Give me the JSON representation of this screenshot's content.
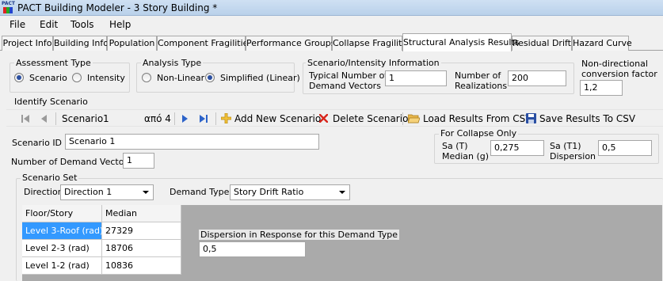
{
  "window": {
    "title": "PACT Building Modeler - 3 Story Building *",
    "logo_text": "PACT"
  },
  "menu": [
    "File",
    "Edit",
    "Tools",
    "Help"
  ],
  "tabs": [
    "Project Info",
    "Building Info",
    "Population",
    "Component Fragilities",
    "Performance Groups",
    "Collapse Fragility",
    "Structural Analysis Results",
    "Residual Drift",
    "Hazard Curve"
  ],
  "active_tab": "Structural Analysis Results",
  "assessment_type": {
    "legend": "Assessment Type",
    "options": [
      "Scenario",
      "Intensity"
    ],
    "selected": "Scenario"
  },
  "analysis_type": {
    "legend": "Analysis Type",
    "options": [
      "Non-Linear",
      "Simplified (Linear)"
    ],
    "selected": "Simplified (Linear)"
  },
  "scenario_info": {
    "legend": "Scenario/Intensity Information",
    "demand_vectors_label": "Typical Number of\nDemand Vectors",
    "demand_vectors_value": "1",
    "realizations_label": "Number of\nRealizations",
    "realizations_value": "200"
  },
  "nondirectional": {
    "label": "Non-directional\nconversion factor",
    "value": "1,2"
  },
  "identify": {
    "legend": "Identify Scenario"
  },
  "navigator": {
    "position_label": "Scenario",
    "position_value": "1",
    "count_text": "από 4",
    "add": "Add New Scenario",
    "delete": "Delete Scenario",
    "load": "Load Results From CSV",
    "save": "Save Results To CSV"
  },
  "scenario_id": {
    "label": "Scenario ID",
    "value": "Scenario 1"
  },
  "num_demand_vectors": {
    "label": "Number of Demand Vectors",
    "value": "1"
  },
  "collapse": {
    "legend": "For Collapse Only",
    "sa_label": "Sa (T)\nMedian (g)",
    "sa_value": "0,275",
    "disp_label": "Sa (T1)\nDispersion",
    "disp_value": "0,5"
  },
  "scenario_set": {
    "legend": "Scenario Set",
    "direction_label": "Direction",
    "direction_value": "Direction 1",
    "demand_type_label": "Demand Type",
    "demand_type_value": "Story Drift Ratio"
  },
  "grid": {
    "columns": [
      "Floor/Story",
      "Median"
    ],
    "rows": [
      {
        "floor": "Level 3-Roof (rad)",
        "median": "27329"
      },
      {
        "floor": "Level 2-3 (rad)",
        "median": "18706"
      },
      {
        "floor": "Level 1-2 (rad)",
        "median": "10836"
      }
    ]
  },
  "dispersion": {
    "label": "Dispersion in Response for this Demand Type",
    "value": "0,5"
  }
}
